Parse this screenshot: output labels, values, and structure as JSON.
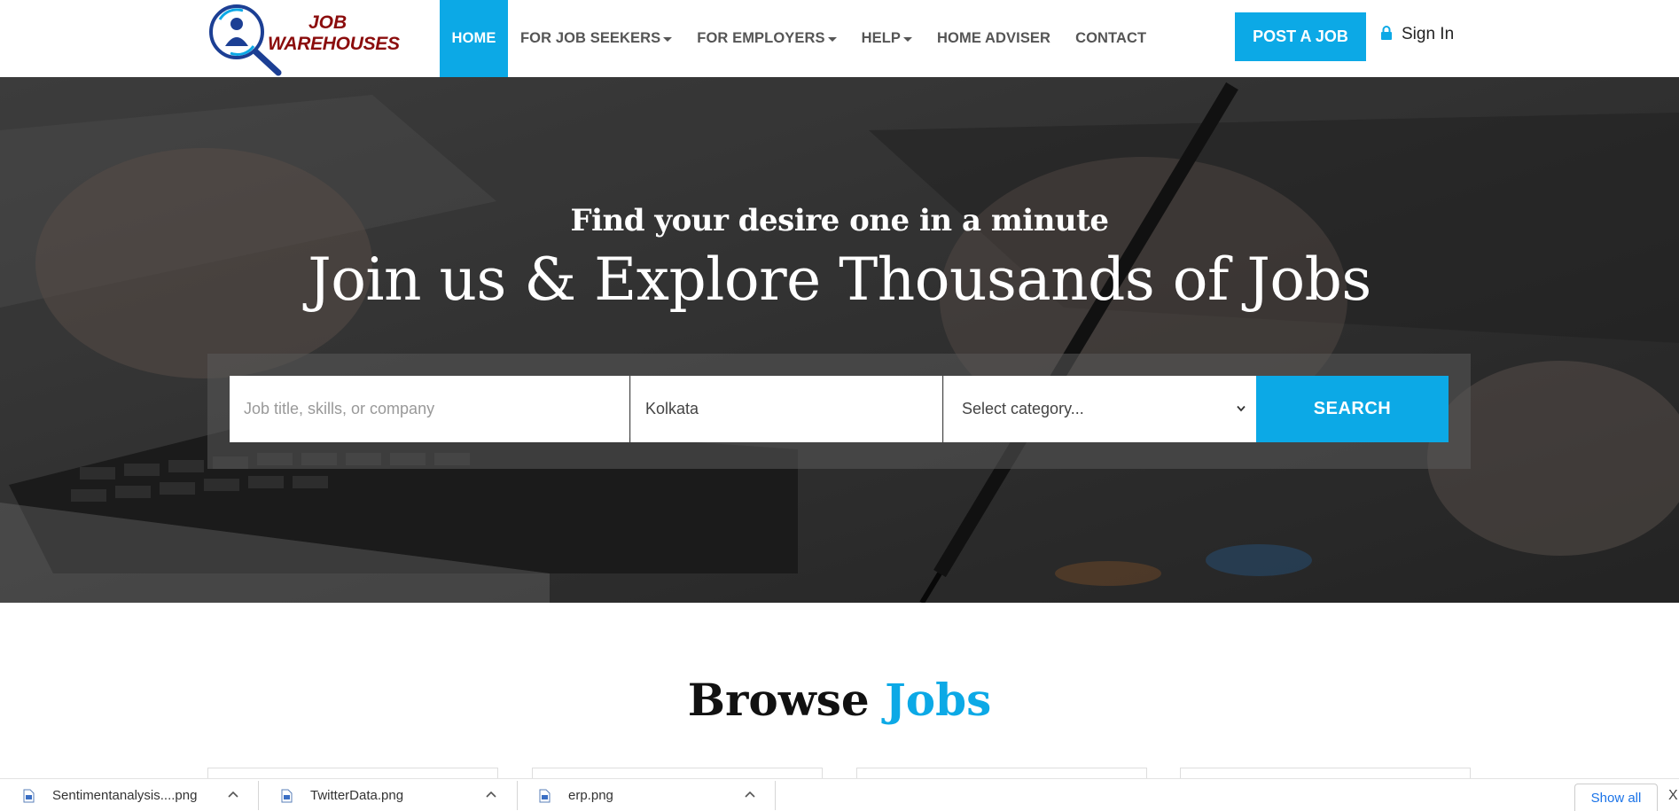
{
  "brand": {
    "line1": "JOB",
    "line2": "WAREHOUSES"
  },
  "nav": {
    "items": [
      {
        "label": "HOME"
      },
      {
        "label": "FOR JOB SEEKERS"
      },
      {
        "label": "FOR EMPLOYERS"
      },
      {
        "label": "HELP"
      },
      {
        "label": "HOME ADVISER"
      },
      {
        "label": "CONTACT"
      }
    ],
    "post_job": "POST A JOB",
    "sign_in": "Sign In"
  },
  "hero": {
    "subtitle": "Find your desire one in a minute",
    "title": "Join us & Explore Thousands of Jobs",
    "search": {
      "keyword_placeholder": "Job title, skills, or company",
      "location_value": "Kolkata",
      "category_selected": "Select category...",
      "button": "SEARCH"
    }
  },
  "browse": {
    "title_plain": "Browse",
    "title_accent": "Jobs"
  },
  "downloads": {
    "items": [
      {
        "name": "Sentimentanalysis....png"
      },
      {
        "name": "TwitterData.png"
      },
      {
        "name": "erp.png"
      }
    ],
    "show_all": "Show all",
    "close": "X"
  },
  "colors": {
    "accent": "#0ca9e6",
    "logo_red": "#8b0c0c",
    "logo_blue": "#1c3f94"
  }
}
